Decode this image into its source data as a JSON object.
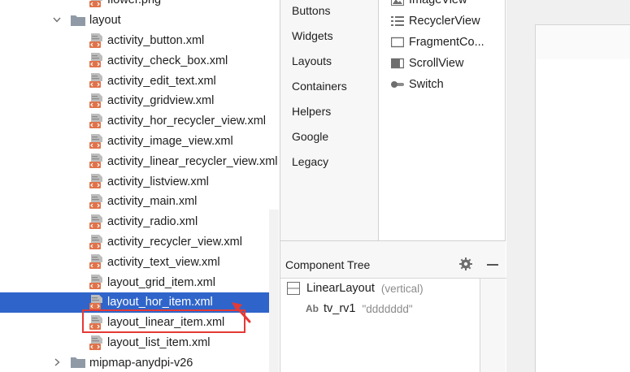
{
  "project_tree": {
    "items": [
      {
        "label": "flower.png",
        "kind": "file"
      },
      {
        "label": "layout",
        "kind": "folder",
        "expanded": true
      },
      {
        "label": "activity_button.xml",
        "kind": "xml"
      },
      {
        "label": "activity_check_box.xml",
        "kind": "xml"
      },
      {
        "label": "activity_edit_text.xml",
        "kind": "xml"
      },
      {
        "label": "activity_gridview.xml",
        "kind": "xml"
      },
      {
        "label": "activity_hor_recycler_view.xml",
        "kind": "xml"
      },
      {
        "label": "activity_image_view.xml",
        "kind": "xml"
      },
      {
        "label": "activity_linear_recycler_view.xml",
        "kind": "xml"
      },
      {
        "label": "activity_listview.xml",
        "kind": "xml"
      },
      {
        "label": "activity_main.xml",
        "kind": "xml"
      },
      {
        "label": "activity_radio.xml",
        "kind": "xml"
      },
      {
        "label": "activity_recycler_view.xml",
        "kind": "xml"
      },
      {
        "label": "activity_text_view.xml",
        "kind": "xml"
      },
      {
        "label": "layout_grid_item.xml",
        "kind": "xml"
      },
      {
        "label": "layout_hor_item.xml",
        "kind": "xml",
        "selected": true
      },
      {
        "label": "layout_linear_item.xml",
        "kind": "xml",
        "highlighted": true
      },
      {
        "label": "layout_list_item.xml",
        "kind": "xml"
      },
      {
        "label": "mipmap-anydpi-v26",
        "kind": "folder",
        "expanded": false
      }
    ]
  },
  "palette": {
    "categories": [
      "Buttons",
      "Widgets",
      "Layouts",
      "Containers",
      "Helpers",
      "Google",
      "Legacy"
    ],
    "items": [
      {
        "label": "ImageView",
        "icon": "image-icon"
      },
      {
        "label": "RecyclerView",
        "icon": "list-icon"
      },
      {
        "label": "FragmentCo...",
        "icon": "fragment-icon"
      },
      {
        "label": "ScrollView",
        "icon": "scroll-icon"
      },
      {
        "label": "Switch",
        "icon": "switch-icon"
      }
    ]
  },
  "component_tree": {
    "title": "Component Tree",
    "nodes": [
      {
        "label": "LinearLayout",
        "hint": "(vertical)",
        "icon": "linear-layout-icon"
      },
      {
        "label": "tv_rv1",
        "hint": "\"ddddddd\"",
        "icon": "textview-icon",
        "icon_text": "Ab"
      }
    ]
  },
  "colors": {
    "selection": "#2f65ca",
    "highlight_box": "#e53935",
    "folder": "#8f9aa6",
    "xml_icon": "#e0724a"
  }
}
